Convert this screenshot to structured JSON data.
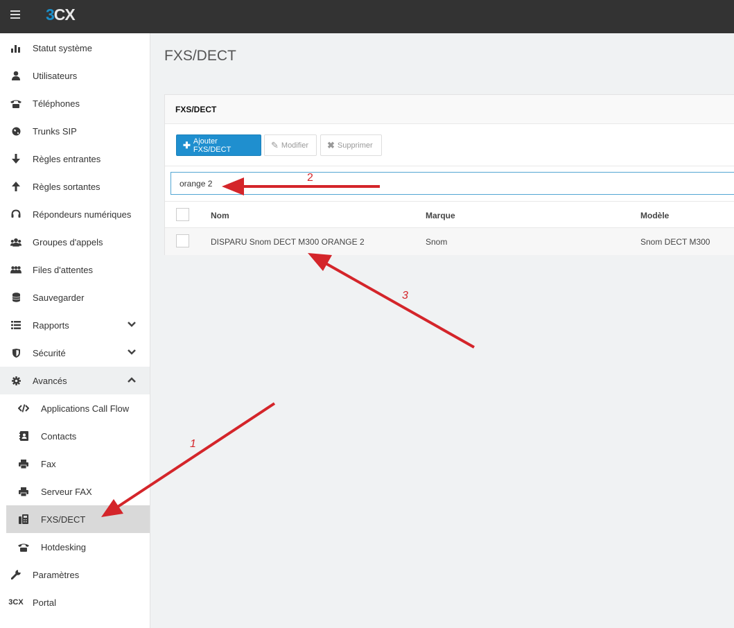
{
  "app": {
    "logo_digit": "3",
    "logo_text": "CX"
  },
  "sidebar": {
    "items": [
      {
        "label": "Statut système",
        "icon": "bar-chart-icon"
      },
      {
        "label": "Utilisateurs",
        "icon": "user-icon"
      },
      {
        "label": "Téléphones",
        "icon": "phone-icon"
      },
      {
        "label": "Trunks SIP",
        "icon": "globe-icon"
      },
      {
        "label": "Règles entrantes",
        "icon": "arrow-down-icon"
      },
      {
        "label": "Règles sortantes",
        "icon": "arrow-up-icon"
      },
      {
        "label": "Répondeurs numériques",
        "icon": "headset-icon"
      },
      {
        "label": "Groupes d'appels",
        "icon": "group-icon"
      },
      {
        "label": "Files d'attentes",
        "icon": "queue-icon"
      },
      {
        "label": "Sauvegarder",
        "icon": "database-icon"
      },
      {
        "label": "Rapports",
        "icon": "list-icon"
      },
      {
        "label": "Sécurité",
        "icon": "shield-icon"
      },
      {
        "label": "Avancés",
        "icon": "gear-icon"
      },
      {
        "label": "Applications Call Flow",
        "icon": "code-icon"
      },
      {
        "label": "Contacts",
        "icon": "contact-book-icon"
      },
      {
        "label": "Fax",
        "icon": "printer-icon"
      },
      {
        "label": "Serveur FAX",
        "icon": "printer-icon"
      },
      {
        "label": "FXS/DECT",
        "icon": "fax-machine-icon"
      },
      {
        "label": "Hotdesking",
        "icon": "phone-icon"
      },
      {
        "label": "Paramètres",
        "icon": "wrench-icon"
      },
      {
        "label": "Portal",
        "icon": "3cx-logo-icon",
        "icon_text": "3CX"
      }
    ]
  },
  "main": {
    "page_title": "FXS/DECT",
    "panel_title": "FXS/DECT",
    "toolbar": {
      "add_label": "Ajouter FXS/DECT",
      "edit_label": "Modifier",
      "delete_label": "Supprimer"
    },
    "search": {
      "value": "orange 2"
    },
    "table": {
      "columns": [
        "Nom",
        "Marque",
        "Modèle"
      ],
      "rows": [
        {
          "nom": "DISPARU Snom DECT M300 ORANGE 2",
          "marque": "Snom",
          "modele": "Snom DECT M300"
        }
      ]
    }
  },
  "annotations": {
    "arrow1": "1",
    "arrow2": "2",
    "arrow3": "3"
  },
  "colors": {
    "accent": "#1f8fcf",
    "topbar": "#333333",
    "annotation": "#d4252a"
  }
}
